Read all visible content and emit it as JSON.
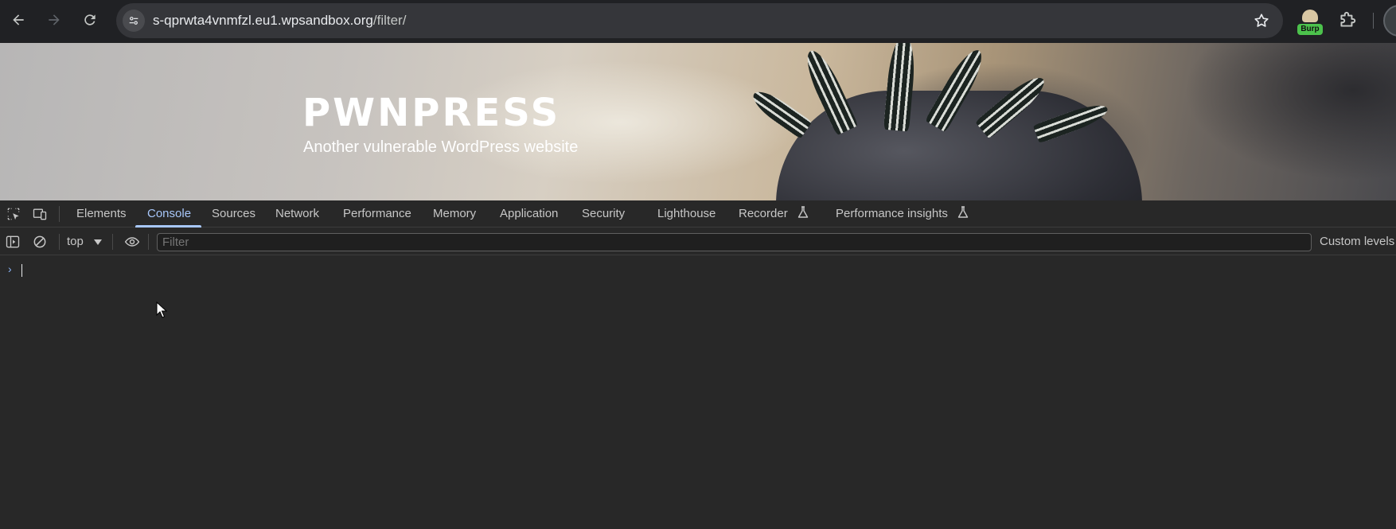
{
  "browser": {
    "url_host": "s-qprwta4vnmfzl.eu1.wpsandbox.org",
    "url_path": "/filter/",
    "extensions": [
      {
        "name": "burp-extension",
        "badge": "Burp"
      }
    ]
  },
  "page": {
    "site_title": "PWNPRESS",
    "tagline": "Another vulnerable WordPress website"
  },
  "devtools": {
    "tabs": [
      {
        "label": "Elements",
        "active": false
      },
      {
        "label": "Console",
        "active": true
      },
      {
        "label": "Sources",
        "active": false
      },
      {
        "label": "Network",
        "active": false
      },
      {
        "label": "Performance",
        "active": false
      },
      {
        "label": "Memory",
        "active": false
      },
      {
        "label": "Application",
        "active": false
      },
      {
        "label": "Security",
        "active": false
      },
      {
        "label": "Lighthouse",
        "active": false
      },
      {
        "label": "Recorder",
        "active": false,
        "experimental": true
      },
      {
        "label": "Performance insights",
        "active": false,
        "experimental": true
      }
    ],
    "console": {
      "context": "top",
      "filter_placeholder": "Filter",
      "levels_label": "Custom levels",
      "prompt_symbol": "›"
    }
  },
  "colors": {
    "accent": "#a8c7fa",
    "devtools_bg": "#282828",
    "toolbar_bg": "#202124"
  }
}
